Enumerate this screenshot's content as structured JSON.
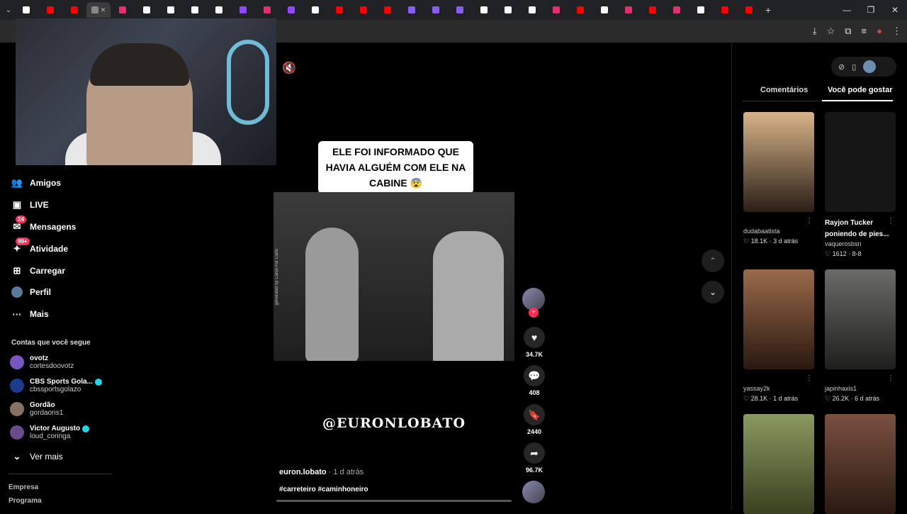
{
  "browser": {
    "tabs": [
      {
        "color": "#ffffff"
      },
      {
        "color": "#ff0000"
      },
      {
        "color": "#ff0000"
      },
      {
        "color": "#888888",
        "active": true
      },
      {
        "color": "#e1306c"
      },
      {
        "color": "#ffffff"
      },
      {
        "color": "#ffffff"
      },
      {
        "color": "#ffffff"
      },
      {
        "color": "#ffffff"
      },
      {
        "color": "#9146ff"
      },
      {
        "color": "#e1306c"
      },
      {
        "color": "#9146ff"
      },
      {
        "color": "#ffffff"
      },
      {
        "color": "#ff0000"
      },
      {
        "color": "#ff0000"
      },
      {
        "color": "#ff0000"
      },
      {
        "color": "#8a5cf6"
      },
      {
        "color": "#8a5cf6"
      },
      {
        "color": "#8a5cf6"
      },
      {
        "color": "#ffffff"
      },
      {
        "color": "#ffffff"
      },
      {
        "color": "#ffffff"
      },
      {
        "color": "#e1306c"
      },
      {
        "color": "#ff0000"
      },
      {
        "color": "#ffffff"
      },
      {
        "color": "#e1306c"
      },
      {
        "color": "#ff0000"
      },
      {
        "color": "#e1306c"
      },
      {
        "color": "#ffffff"
      },
      {
        "color": "#ff0000"
      },
      {
        "color": "#ff0000"
      }
    ],
    "new_tab_glyph": "+",
    "window_controls": {
      "minimize": "—",
      "restore": "❐",
      "close": "✕"
    }
  },
  "sidebar": {
    "items": [
      {
        "name": "friends",
        "label": "Amigos",
        "icon": "👥"
      },
      {
        "name": "live",
        "label": "LIVE",
        "icon": "📺"
      },
      {
        "name": "messages",
        "label": "Mensagens",
        "icon": "✉",
        "badge": "24"
      },
      {
        "name": "activity",
        "label": "Atividade",
        "icon": "💬",
        "badge": "99+"
      },
      {
        "name": "upload",
        "label": "Carregar",
        "icon": "⊕"
      },
      {
        "name": "profile",
        "label": "Perfil",
        "icon": "●"
      },
      {
        "name": "more",
        "label": "Mais",
        "icon": "···"
      }
    ],
    "following_title": "Contas que você segue",
    "accounts": [
      {
        "name": "ovotz",
        "handle": "cortesdoovotz",
        "verified": false,
        "color": "#7a55c0"
      },
      {
        "name": "CBS Sports Gola...",
        "handle": "cbssportsgolazo",
        "verified": true,
        "color": "#1a3d8f"
      },
      {
        "name": "Gordão",
        "handle": "gordaons1",
        "verified": false,
        "color": "#8a7060"
      },
      {
        "name": "Victor Augusto",
        "handle": "loud_coringa",
        "verified": true,
        "color": "#6a4a8a"
      }
    ],
    "see_more": "Ver mais",
    "footer": [
      "Empresa",
      "Programa"
    ]
  },
  "video": {
    "caption_overlay": "ELE FOI INFORMADO QUE HAVIA ALGUÉM COM ELE NA CABINE 😨",
    "watermark": "generated by Canal Por Carla",
    "handle_overlay": "@EURONLOBATO",
    "author": "euron.lobato",
    "time": " · 1 d atrás",
    "hashtags": "#carreteiro #caminhoneiro",
    "progress": 0
  },
  "actions": {
    "likes": "34.7K",
    "comments": "408",
    "saves": "2440",
    "shares": "96.7K"
  },
  "right_panel": {
    "tabs": [
      "Comentários",
      "Você pode gostar"
    ],
    "cards": [
      {
        "title": "",
        "user": "dudabaatista",
        "likes": "18.1K",
        "time": "3 d atrás",
        "color": "#c8a07a"
      },
      {
        "title": "Rayjon Tucker poniendo de pies...",
        "user": "vaquerosbsn",
        "likes": "1612",
        "time": "8-8",
        "color": "#111111"
      },
      {
        "title": "",
        "user": "yassay2k",
        "likes": "28.1K",
        "time": "1 d atrás",
        "color": "#8a5a40"
      },
      {
        "title": "",
        "user": "japinhaxis1",
        "likes": "26.2K",
        "time": "6 d atrás",
        "color": "#5a5a58"
      },
      {
        "title": "",
        "user": "",
        "likes": "",
        "time": "",
        "color": "#7a8a50"
      },
      {
        "title": "",
        "user": "",
        "likes": "",
        "time": "",
        "color": "#6a4a38"
      }
    ]
  }
}
